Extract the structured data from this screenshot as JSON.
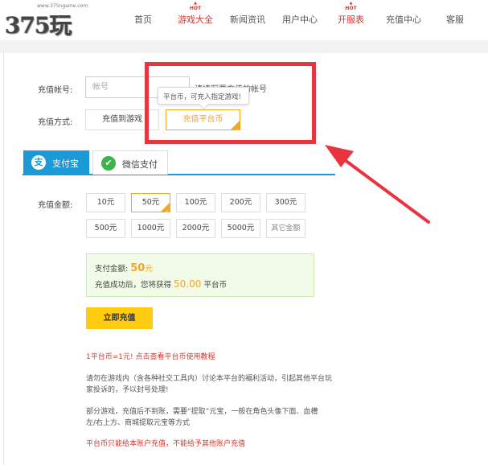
{
  "header": {
    "logo_url_text": "www.375ngame.com",
    "logo_text": "375玩",
    "nav": [
      {
        "label": "首页",
        "hot": false
      },
      {
        "label": "游戏大全",
        "hot": true
      },
      {
        "label": "新闻资讯",
        "hot": false
      },
      {
        "label": "用户中心",
        "hot": false
      },
      {
        "label": "开服表",
        "hot": true
      },
      {
        "label": "充值中心",
        "hot": false
      },
      {
        "label": "客服",
        "hot": false
      }
    ],
    "hot_badge": "HOT"
  },
  "form": {
    "account_label": "充值帐号:",
    "account_placeholder": "帐号",
    "account_hint": "请填写要充值的帐号",
    "method_label": "充值方式:",
    "method_options": [
      "充值到游戏",
      "充值平台币"
    ],
    "method_selected": "充值平台币",
    "tooltip_text": "平台币，可充入指定游戏!"
  },
  "tabs": [
    {
      "label": "支付宝",
      "icon": "alipay-icon",
      "active": true
    },
    {
      "label": "微信支付",
      "icon": "wechat-icon",
      "active": false
    }
  ],
  "amount": {
    "label": "充值金额:",
    "options": [
      "10元",
      "50元",
      "100元",
      "200元",
      "300元",
      "500元",
      "1000元",
      "2000元",
      "5000元",
      "其它金额"
    ],
    "selected": "50元"
  },
  "summary": {
    "pay_label": "支付金额:",
    "pay_value": "50",
    "pay_unit": "元",
    "receive_prefix": "充值成功后，您将获得",
    "receive_value": "50.00",
    "receive_unit": "平台币"
  },
  "submit_label": "立即充值",
  "notes": {
    "rate": "1平台币=1元! 点击查看平台币使用教程",
    "warning_line1": "请勿在游戏内（含各种社交工具内）讨论本平台的福利活动，引起其他平台玩",
    "warning_line2": "家投诉的，予以封号处理!",
    "extract_line1": "部分游戏，充值后不到账，需要“提取”元宝，一般在角色头像下面、血槽",
    "extract_line2": "左/右上方、商城提取元宝等方式",
    "restriction": "平台币只能给本账户充值，不能给予其他账户充值"
  },
  "colors": {
    "accent_orange": "#f5a623",
    "nav_red": "#e0332a",
    "annotation_red": "#e8343f",
    "alipay_blue": "#1b9ad6",
    "wechat_green": "#3bb54a",
    "submit_yellow": "#ffcc11"
  }
}
